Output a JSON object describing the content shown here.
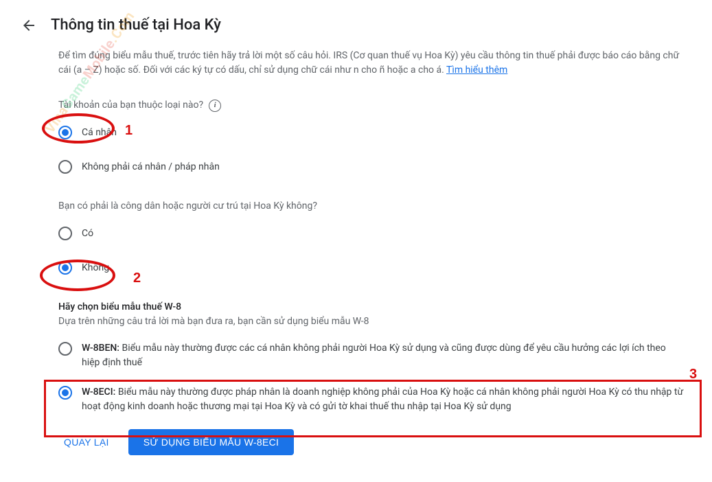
{
  "header": {
    "title": "Thông tin thuế tại Hoa Kỳ"
  },
  "intro": {
    "text": "Để tìm đúng biểu mẫu thuế, trước tiên hãy trả lời một số câu hỏi. IRS (Cơ quan thuế vụ Hoa Kỳ) yêu cầu thông tin thuế phải được báo cáo bằng chữ cái (a – Z) hoặc số. Đối với các ký tự có dấu, chỉ sử dụng chữ cái như n cho ñ hoặc a cho á. ",
    "link": "Tìm hiểu thêm"
  },
  "q1": {
    "label": "Tài khoản của bạn thuộc loại nào?",
    "opt1": "Cá nhân",
    "opt2": "Không phải cá nhân / pháp nhân"
  },
  "q2": {
    "label": "Bạn có phải là công dân hoặc người cư trú tại Hoa Kỳ không?",
    "opt1": "Có",
    "opt2": "Không"
  },
  "q3": {
    "heading": "Hãy chọn biểu mẫu thuế W-8",
    "sub": "Dựa trên những câu trả lời mà bạn đưa ra, bạn cần sử dụng biểu mẫu W-8",
    "opt1_name": "W-8BEN:",
    "opt1_desc": " Biểu mẫu này thường được các cá nhân không phải người Hoa Kỳ sử dụng và cũng được dùng để yêu cầu hưởng các lợi ích theo hiệp định thuế",
    "opt2_name": "W-8ECI:",
    "opt2_desc": " Biểu mẫu này thường được pháp nhân là doanh nghiệp không phải của Hoa Kỳ hoặc cá nhân không phải người Hoa Kỳ có thu nhập từ hoạt động kinh doanh hoặc thương mại tại Hoa Kỳ và có gửi tờ khai thuế thu nhập tại Hoa Kỳ sử dụng"
  },
  "buttons": {
    "back": "Quay lại",
    "submit": "Sử dụng biểu mẫu W-8ECI"
  },
  "annotations": {
    "n1": "1",
    "n2": "2",
    "n3": "3"
  },
  "watermark": {
    "t1": "Vina",
    "t2": "Game",
    "t3": "Mobile",
    "t4": ".Com"
  }
}
